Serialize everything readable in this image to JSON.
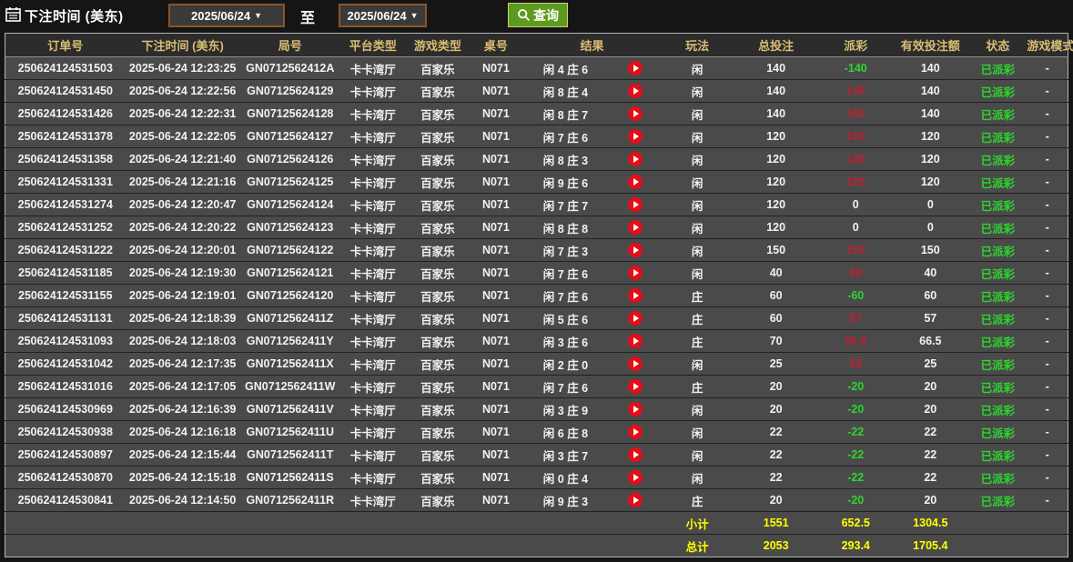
{
  "filters": {
    "label": "下注时间 (美东)",
    "date_from": "2025/06/24",
    "to_label": "至",
    "date_to": "2025/06/24",
    "search_label": "查询"
  },
  "icons": {
    "calendar": "calendar-icon",
    "search": "search-icon",
    "dropdown": "chevron-down-icon",
    "row_action": "play-icon"
  },
  "colors": {
    "header_gold": "#d8bd72",
    "win_red": "#c01f30",
    "loss_green": "#2ed52e",
    "total_yellow": "#ffff00",
    "button_green": "#5d9b1e",
    "date_border_brown": "#8a552a",
    "play_icon_red": "#e60c18",
    "row_bg": "#4a4a4a"
  },
  "table": {
    "columns": [
      "订单号",
      "下注时间 (美东)",
      "局号",
      "平台类型",
      "游戏类型",
      "桌号",
      "结果",
      "玩法",
      "总投注",
      "派彩",
      "有效投注额",
      "状态",
      "游戏模式"
    ],
    "rows": [
      {
        "order_id": "250624124531503",
        "bet_time": "2025-06-24 12:23:25",
        "round_id": "GN0712562412A",
        "platform": "卡卡湾厅",
        "game_type": "百家乐",
        "table_no": "N071",
        "result": "闲 4 庄 6",
        "play": "闲",
        "total_bet": "140",
        "payout": "-140",
        "valid_bet": "140",
        "status": "已派彩",
        "game_mode": "-"
      },
      {
        "order_id": "250624124531450",
        "bet_time": "2025-06-24 12:22:56",
        "round_id": "GN07125624129",
        "platform": "卡卡湾厅",
        "game_type": "百家乐",
        "table_no": "N071",
        "result": "闲 8 庄 4",
        "play": "闲",
        "total_bet": "140",
        "payout": "140",
        "valid_bet": "140",
        "status": "已派彩",
        "game_mode": "-"
      },
      {
        "order_id": "250624124531426",
        "bet_time": "2025-06-24 12:22:31",
        "round_id": "GN07125624128",
        "platform": "卡卡湾厅",
        "game_type": "百家乐",
        "table_no": "N071",
        "result": "闲 8 庄 7",
        "play": "闲",
        "total_bet": "140",
        "payout": "140",
        "valid_bet": "140",
        "status": "已派彩",
        "game_mode": "-"
      },
      {
        "order_id": "250624124531378",
        "bet_time": "2025-06-24 12:22:05",
        "round_id": "GN07125624127",
        "platform": "卡卡湾厅",
        "game_type": "百家乐",
        "table_no": "N071",
        "result": "闲 7 庄 6",
        "play": "闲",
        "total_bet": "120",
        "payout": "120",
        "valid_bet": "120",
        "status": "已派彩",
        "game_mode": "-"
      },
      {
        "order_id": "250624124531358",
        "bet_time": "2025-06-24 12:21:40",
        "round_id": "GN07125624126",
        "platform": "卡卡湾厅",
        "game_type": "百家乐",
        "table_no": "N071",
        "result": "闲 8 庄 3",
        "play": "闲",
        "total_bet": "120",
        "payout": "120",
        "valid_bet": "120",
        "status": "已派彩",
        "game_mode": "-"
      },
      {
        "order_id": "250624124531331",
        "bet_time": "2025-06-24 12:21:16",
        "round_id": "GN07125624125",
        "platform": "卡卡湾厅",
        "game_type": "百家乐",
        "table_no": "N071",
        "result": "闲 9 庄 6",
        "play": "闲",
        "total_bet": "120",
        "payout": "120",
        "valid_bet": "120",
        "status": "已派彩",
        "game_mode": "-"
      },
      {
        "order_id": "250624124531274",
        "bet_time": "2025-06-24 12:20:47",
        "round_id": "GN07125624124",
        "platform": "卡卡湾厅",
        "game_type": "百家乐",
        "table_no": "N071",
        "result": "闲 7 庄 7",
        "play": "闲",
        "total_bet": "120",
        "payout": "0",
        "valid_bet": "0",
        "status": "已派彩",
        "game_mode": "-"
      },
      {
        "order_id": "250624124531252",
        "bet_time": "2025-06-24 12:20:22",
        "round_id": "GN07125624123",
        "platform": "卡卡湾厅",
        "game_type": "百家乐",
        "table_no": "N071",
        "result": "闲 8 庄 8",
        "play": "闲",
        "total_bet": "120",
        "payout": "0",
        "valid_bet": "0",
        "status": "已派彩",
        "game_mode": "-"
      },
      {
        "order_id": "250624124531222",
        "bet_time": "2025-06-24 12:20:01",
        "round_id": "GN07125624122",
        "platform": "卡卡湾厅",
        "game_type": "百家乐",
        "table_no": "N071",
        "result": "闲 7 庄 3",
        "play": "闲",
        "total_bet": "150",
        "payout": "150",
        "valid_bet": "150",
        "status": "已派彩",
        "game_mode": "-"
      },
      {
        "order_id": "250624124531185",
        "bet_time": "2025-06-24 12:19:30",
        "round_id": "GN07125624121",
        "platform": "卡卡湾厅",
        "game_type": "百家乐",
        "table_no": "N071",
        "result": "闲 7 庄 6",
        "play": "闲",
        "total_bet": "40",
        "payout": "40",
        "valid_bet": "40",
        "status": "已派彩",
        "game_mode": "-"
      },
      {
        "order_id": "250624124531155",
        "bet_time": "2025-06-24 12:19:01",
        "round_id": "GN07125624120",
        "platform": "卡卡湾厅",
        "game_type": "百家乐",
        "table_no": "N071",
        "result": "闲 7 庄 6",
        "play": "庄",
        "total_bet": "60",
        "payout": "-60",
        "valid_bet": "60",
        "status": "已派彩",
        "game_mode": "-"
      },
      {
        "order_id": "250624124531131",
        "bet_time": "2025-06-24 12:18:39",
        "round_id": "GN0712562411Z",
        "platform": "卡卡湾厅",
        "game_type": "百家乐",
        "table_no": "N071",
        "result": "闲 5 庄 6",
        "play": "庄",
        "total_bet": "60",
        "payout": "57",
        "valid_bet": "57",
        "status": "已派彩",
        "game_mode": "-"
      },
      {
        "order_id": "250624124531093",
        "bet_time": "2025-06-24 12:18:03",
        "round_id": "GN0712562411Y",
        "platform": "卡卡湾厅",
        "game_type": "百家乐",
        "table_no": "N071",
        "result": "闲 3 庄 6",
        "play": "庄",
        "total_bet": "70",
        "payout": "66.5",
        "valid_bet": "66.5",
        "status": "已派彩",
        "game_mode": "-"
      },
      {
        "order_id": "250624124531042",
        "bet_time": "2025-06-24 12:17:35",
        "round_id": "GN0712562411X",
        "platform": "卡卡湾厅",
        "game_type": "百家乐",
        "table_no": "N071",
        "result": "闲 2 庄 0",
        "play": "闲",
        "total_bet": "25",
        "payout": "25",
        "valid_bet": "25",
        "status": "已派彩",
        "game_mode": "-"
      },
      {
        "order_id": "250624124531016",
        "bet_time": "2025-06-24 12:17:05",
        "round_id": "GN0712562411W",
        "platform": "卡卡湾厅",
        "game_type": "百家乐",
        "table_no": "N071",
        "result": "闲 7 庄 6",
        "play": "庄",
        "total_bet": "20",
        "payout": "-20",
        "valid_bet": "20",
        "status": "已派彩",
        "game_mode": "-"
      },
      {
        "order_id": "250624124530969",
        "bet_time": "2025-06-24 12:16:39",
        "round_id": "GN0712562411V",
        "platform": "卡卡湾厅",
        "game_type": "百家乐",
        "table_no": "N071",
        "result": "闲 3 庄 9",
        "play": "闲",
        "total_bet": "20",
        "payout": "-20",
        "valid_bet": "20",
        "status": "已派彩",
        "game_mode": "-"
      },
      {
        "order_id": "250624124530938",
        "bet_time": "2025-06-24 12:16:18",
        "round_id": "GN0712562411U",
        "platform": "卡卡湾厅",
        "game_type": "百家乐",
        "table_no": "N071",
        "result": "闲 6 庄 8",
        "play": "闲",
        "total_bet": "22",
        "payout": "-22",
        "valid_bet": "22",
        "status": "已派彩",
        "game_mode": "-"
      },
      {
        "order_id": "250624124530897",
        "bet_time": "2025-06-24 12:15:44",
        "round_id": "GN0712562411T",
        "platform": "卡卡湾厅",
        "game_type": "百家乐",
        "table_no": "N071",
        "result": "闲 3 庄 7",
        "play": "闲",
        "total_bet": "22",
        "payout": "-22",
        "valid_bet": "22",
        "status": "已派彩",
        "game_mode": "-"
      },
      {
        "order_id": "250624124530870",
        "bet_time": "2025-06-24 12:15:18",
        "round_id": "GN0712562411S",
        "platform": "卡卡湾厅",
        "game_type": "百家乐",
        "table_no": "N071",
        "result": "闲 0 庄 4",
        "play": "闲",
        "total_bet": "22",
        "payout": "-22",
        "valid_bet": "22",
        "status": "已派彩",
        "game_mode": "-"
      },
      {
        "order_id": "250624124530841",
        "bet_time": "2025-06-24 12:14:50",
        "round_id": "GN0712562411R",
        "platform": "卡卡湾厅",
        "game_type": "百家乐",
        "table_no": "N071",
        "result": "闲 9 庄 3",
        "play": "庄",
        "total_bet": "20",
        "payout": "-20",
        "valid_bet": "20",
        "status": "已派彩",
        "game_mode": "-"
      }
    ],
    "subtotal": {
      "label": "小计",
      "total_bet": "1551",
      "payout": "652.5",
      "valid_bet": "1304.5"
    },
    "grand_total": {
      "label": "总计",
      "total_bet": "2053",
      "payout": "293.4",
      "valid_bet": "1705.4"
    }
  }
}
